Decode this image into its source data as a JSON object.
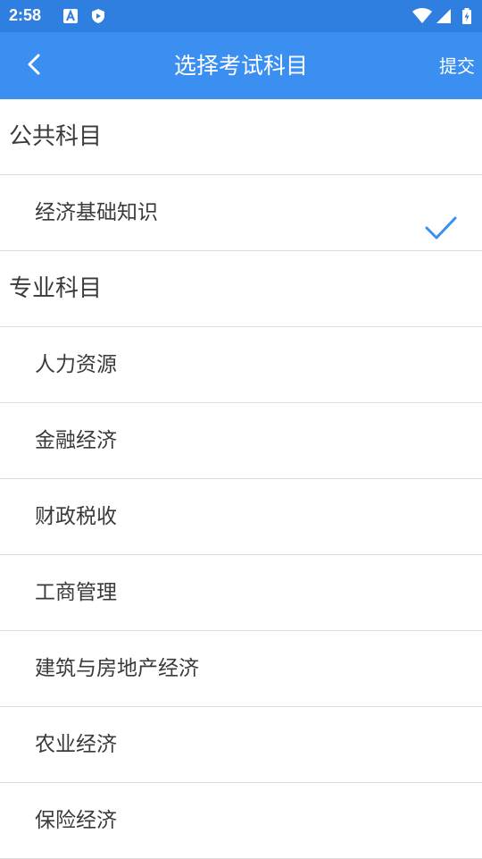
{
  "status_bar": {
    "time": "2:58",
    "icons": [
      "a-notification-icon",
      "shield-icon",
      "wifi-icon",
      "signal-icon",
      "battery-icon"
    ]
  },
  "app_bar": {
    "back_icon": "chevron-left-icon",
    "title": "选择考试科目",
    "submit_label": "提交"
  },
  "colors": {
    "status_bar": "#2f7fe0",
    "app_bar": "#3b8ff0",
    "check": "#3b8ff0",
    "text": "#3a3a3a",
    "divider": "#dcdcdc"
  },
  "sections": [
    {
      "title": "公共科目",
      "items": [
        {
          "label": "经济基础知识",
          "selected": true
        }
      ]
    },
    {
      "title": "专业科目",
      "items": [
        {
          "label": "人力资源",
          "selected": false
        },
        {
          "label": "金融经济",
          "selected": false
        },
        {
          "label": "财政税收",
          "selected": false
        },
        {
          "label": "工商管理",
          "selected": false
        },
        {
          "label": "建筑与房地产经济",
          "selected": false
        },
        {
          "label": "农业经济",
          "selected": false
        },
        {
          "label": "保险经济",
          "selected": false
        }
      ]
    }
  ]
}
